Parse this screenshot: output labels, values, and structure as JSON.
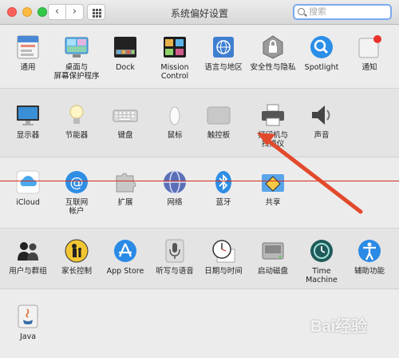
{
  "window": {
    "title": "系统偏好设置"
  },
  "search": {
    "placeholder": "搜索"
  },
  "rows": [
    [
      {
        "label": "通用",
        "icon": "general-icon"
      },
      {
        "label": "桌面与\n屏幕保护程序",
        "icon": "desktop-screensaver-icon"
      },
      {
        "label": "Dock",
        "icon": "dock-icon"
      },
      {
        "label": "Mission\nControl",
        "icon": "mission-control-icon"
      },
      {
        "label": "语言与地区",
        "icon": "language-region-icon"
      },
      {
        "label": "安全性与隐私",
        "icon": "security-privacy-icon"
      },
      {
        "label": "Spotlight",
        "icon": "spotlight-icon"
      },
      {
        "label": "通知",
        "icon": "notifications-icon"
      }
    ],
    [
      {
        "label": "显示器",
        "icon": "displays-icon"
      },
      {
        "label": "节能器",
        "icon": "energy-saver-icon"
      },
      {
        "label": "键盘",
        "icon": "keyboard-icon"
      },
      {
        "label": "鼠标",
        "icon": "mouse-icon"
      },
      {
        "label": "触控板",
        "icon": "trackpad-icon"
      },
      {
        "label": "打印机与\n扫描仪",
        "icon": "printers-scanners-icon"
      },
      {
        "label": "声音",
        "icon": "sound-icon"
      }
    ],
    [
      {
        "label": "iCloud",
        "icon": "icloud-icon"
      },
      {
        "label": "互联网\n帐户",
        "icon": "internet-accounts-icon"
      },
      {
        "label": "扩展",
        "icon": "extensions-icon"
      },
      {
        "label": "网络",
        "icon": "network-icon"
      },
      {
        "label": "蓝牙",
        "icon": "bluetooth-icon"
      },
      {
        "label": "共享",
        "icon": "sharing-icon"
      }
    ],
    [
      {
        "label": "用户与群组",
        "icon": "users-groups-icon"
      },
      {
        "label": "家长控制",
        "icon": "parental-controls-icon"
      },
      {
        "label": "App Store",
        "icon": "app-store-icon"
      },
      {
        "label": "听写与语音",
        "icon": "dictation-speech-icon"
      },
      {
        "label": "日期与时间",
        "icon": "date-time-icon"
      },
      {
        "label": "启动磁盘",
        "icon": "startup-disk-icon"
      },
      {
        "label": "Time Machine",
        "icon": "time-machine-icon"
      },
      {
        "label": "辅助功能",
        "icon": "accessibility-icon"
      }
    ],
    [
      {
        "label": "Java",
        "icon": "java-icon"
      }
    ]
  ],
  "watermark": "Bai经验",
  "colors": {
    "arrow": "#e24a2c",
    "accent": "#3b8ee8"
  }
}
